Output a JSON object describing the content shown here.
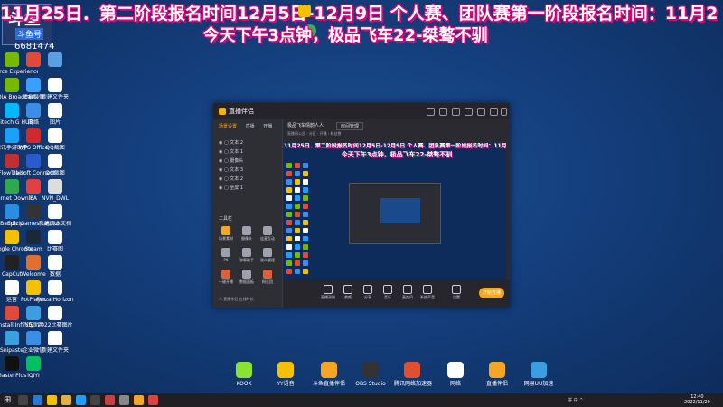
{
  "overlay": {
    "marquee": "11月25日．第二阶段报名时间12月5日-12月9日 个人赛、团队赛第一阶段报名时间：11月2",
    "subtitle": "今天下午3点钟，极品飞车22-桀骜不驯",
    "logo_text": "斗鱼",
    "logo_sub": "斗鱼号",
    "room_number": "6681474"
  },
  "desktop_icons": [
    {
      "label": "GeForce Experience",
      "icon": "geforce-icon",
      "color": "#76b900"
    },
    {
      "label": "",
      "icon": "app-icon",
      "color": "#e04a3a"
    },
    {
      "label": "",
      "icon": "app-icon",
      "color": "#5aa0e0"
    },
    {
      "label": "NVIDIA Broadcast",
      "icon": "nvidia-icon",
      "color": "#76b900"
    },
    {
      "label": "虚拟摄像",
      "icon": "camera-icon",
      "color": "#3aa0ff"
    },
    {
      "label": "新建文件夹",
      "icon": "folder-icon",
      "color": "#ffffff"
    },
    {
      "label": "Logitech G HUB",
      "icon": "logitech-icon",
      "color": "#00b8fc"
    },
    {
      "label": "网络",
      "icon": "network-icon",
      "color": "#3a8ee6"
    },
    {
      "label": "图片",
      "icon": "image-icon",
      "color": "#ffffff"
    },
    {
      "label": "腾讯手游助手",
      "icon": "game-icon",
      "color": "#1aa1ff"
    },
    {
      "label": "WPS Office",
      "icon": "wps-icon",
      "color": "#d02a2a"
    },
    {
      "label": "QQ截图",
      "icon": "screenshot-icon",
      "color": "#ffffff"
    },
    {
      "label": "FlowTrack",
      "icon": "app-icon",
      "color": "#c03030"
    },
    {
      "label": "Ubisoft Connect",
      "icon": "ubisoft-icon",
      "color": "#2a5ad0"
    },
    {
      "label": "QQ截图",
      "icon": "screenshot-icon",
      "color": "#ffffff"
    },
    {
      "label": "Internet Downlo",
      "icon": "download-icon",
      "color": "#2fa84f"
    },
    {
      "label": "EA",
      "icon": "ea-icon",
      "color": "#e04040"
    },
    {
      "label": "NVN_DWL",
      "icon": "file-icon",
      "color": "#dddddd"
    },
    {
      "label": "Bandizip",
      "icon": "bandizip-icon",
      "color": "#2a8ee0"
    },
    {
      "label": "Epic Games Launcher",
      "icon": "epic-icon",
      "color": "#333333"
    },
    {
      "label": "新建文本文档",
      "icon": "text-icon",
      "color": "#ffffff"
    },
    {
      "label": "Google Chrome",
      "icon": "chrome-icon",
      "color": "#f2c200"
    },
    {
      "label": "Steam",
      "icon": "steam-icon",
      "color": "#1b2838"
    },
    {
      "label": "比赛图",
      "icon": "image-icon",
      "color": "#ffffff"
    },
    {
      "label": "CapCut",
      "icon": "capcut-icon",
      "color": "#222222"
    },
    {
      "label": "Welcome",
      "icon": "app-icon",
      "color": "#e07030"
    },
    {
      "label": "数据",
      "icon": "file-icon",
      "color": "#ffffff"
    },
    {
      "label": "运营",
      "icon": "app-icon",
      "color": "#ffffff"
    },
    {
      "label": "PotPlayer",
      "icon": "potplayer-icon",
      "color": "#f5c000"
    },
    {
      "label": "Forza Horizon",
      "icon": "forza-icon",
      "color": "#ffffff"
    },
    {
      "label": "Uninstall Infinity",
      "icon": "uninstall-icon",
      "color": "#e04a3a"
    },
    {
      "label": "飞车助手",
      "icon": "app-icon",
      "color": "#3a9ee0"
    },
    {
      "label": "2022比赛图片",
      "icon": "folder-icon",
      "color": "#ffffff"
    },
    {
      "label": "Snipaste",
      "icon": "snipaste-icon",
      "color": "#3aa0e0"
    },
    {
      "label": "企业微信",
      "icon": "wechat-icon",
      "color": "#3a8ee6"
    },
    {
      "label": "新建文件夹",
      "icon": "folder-icon",
      "color": "#ffffff"
    },
    {
      "label": "MasterPlus",
      "icon": "masterplus-icon",
      "color": "#111111"
    },
    {
      "label": "iQIYI",
      "icon": "iqiyi-icon",
      "color": "#00c060"
    }
  ],
  "dock_icons": [
    {
      "label": "KOOK",
      "icon": "kook-icon",
      "color": "#8ae234"
    },
    {
      "label": "YY语音",
      "icon": "yy-icon",
      "color": "#f5c000"
    },
    {
      "label": "斗鱼直播伴侣",
      "icon": "douyu-icon",
      "color": "#f5a623"
    },
    {
      "label": "OBS Studio",
      "icon": "obs-icon",
      "color": "#333333"
    },
    {
      "label": "腾讯网络加速器",
      "icon": "accelerator-icon",
      "color": "#e05030"
    },
    {
      "label": "网络",
      "icon": "network-icon",
      "color": "#ffffff"
    },
    {
      "label": "直播伴侣",
      "icon": "live-icon",
      "color": "#f5a623"
    },
    {
      "label": "网易UU加速",
      "icon": "uu-icon",
      "color": "#3a9ee0"
    }
  ],
  "window": {
    "brand": "直播伴侣",
    "tabs": [
      "场景设置",
      "直播",
      "开播"
    ],
    "scenes": [
      "文本 2",
      "文本 1",
      "摄像头",
      "文本 3",
      "文本 2",
      "全屏 1"
    ],
    "tools_label": "工具栏",
    "tools": [
      "场景素材",
      "摄像头",
      "连麦互动",
      "PK",
      "弹幕助手",
      "观众管理",
      "一键开播",
      "数据面板",
      "粉丝团"
    ],
    "footer": "人 直播伴侣 在线时长",
    "header": {
      "title": "极品飞车情韵人人",
      "pill": "房间管理",
      "info": "直播间公告 · 分区 · 开播 · 粉丝数"
    },
    "bottom_buttons": [
      "直播录制",
      "美颜",
      "分享",
      "音乐",
      "麦克风",
      "系统声音",
      "设置"
    ],
    "go_live": "开始直播"
  },
  "preview": {
    "marquee": "11月25日．第二阶段报名时间12月5日-12月9日 个人赛、团队赛第一阶段报名时间：11月2",
    "subtitle": "今天下午3点钟，极品飞车22-桀骜不驯"
  },
  "taskbar": {
    "tray_text": "拼 中 ^",
    "time": "12:40",
    "date": "2022/11/29"
  }
}
